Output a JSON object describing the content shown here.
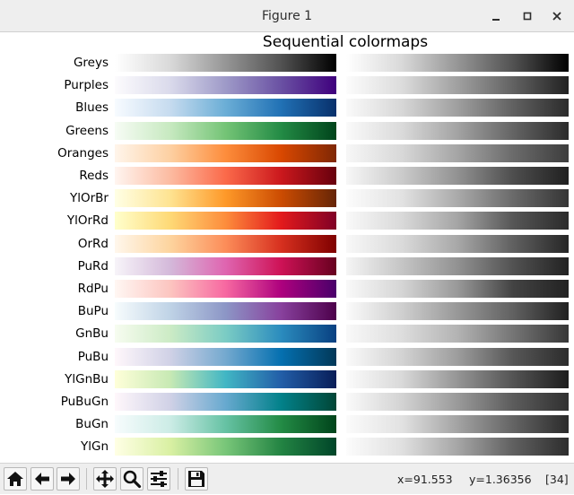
{
  "window": {
    "title": "Figure 1"
  },
  "figure": {
    "title": "Sequential colormaps"
  },
  "colormaps": [
    {
      "name": "Greys",
      "colors": [
        "#ffffff",
        "#d9d9d9",
        "#969696",
        "#525252",
        "#000000"
      ]
    },
    {
      "name": "Purples",
      "colors": [
        "#fcfbfd",
        "#dadaeb",
        "#9e9ac8",
        "#6a51a3",
        "#3f007d"
      ]
    },
    {
      "name": "Blues",
      "colors": [
        "#f7fbff",
        "#c6dbef",
        "#6baed6",
        "#2171b5",
        "#08306b"
      ]
    },
    {
      "name": "Greens",
      "colors": [
        "#f7fcf5",
        "#c7e9c0",
        "#74c476",
        "#238b45",
        "#00441b"
      ]
    },
    {
      "name": "Oranges",
      "colors": [
        "#fff5eb",
        "#fdd0a2",
        "#fd8d3c",
        "#d94801",
        "#7f2704"
      ]
    },
    {
      "name": "Reds",
      "colors": [
        "#fff5f0",
        "#fcbba1",
        "#fb6a4a",
        "#cb181d",
        "#67000d"
      ]
    },
    {
      "name": "YlOrBr",
      "colors": [
        "#ffffe5",
        "#fee391",
        "#fe9929",
        "#cc4c02",
        "#662506"
      ]
    },
    {
      "name": "YlOrRd",
      "colors": [
        "#ffffcc",
        "#fed976",
        "#fd8d3c",
        "#e31a1c",
        "#800026"
      ]
    },
    {
      "name": "OrRd",
      "colors": [
        "#fff7ec",
        "#fdd49e",
        "#fc8d59",
        "#d7301f",
        "#7f0000"
      ]
    },
    {
      "name": "PuRd",
      "colors": [
        "#f7f4f9",
        "#d4b9da",
        "#df65b0",
        "#ce1256",
        "#67001f"
      ]
    },
    {
      "name": "RdPu",
      "colors": [
        "#fff7f3",
        "#fcc5c0",
        "#f768a1",
        "#ae017e",
        "#49006a"
      ]
    },
    {
      "name": "BuPu",
      "colors": [
        "#f7fcfd",
        "#bfd3e6",
        "#8c96c6",
        "#88419d",
        "#4d004b"
      ]
    },
    {
      "name": "GnBu",
      "colors": [
        "#f7fcf0",
        "#ccebc5",
        "#7bccc4",
        "#2b8cbe",
        "#084081"
      ]
    },
    {
      "name": "PuBu",
      "colors": [
        "#fff7fb",
        "#d0d1e6",
        "#74a9cf",
        "#0570b0",
        "#023858"
      ]
    },
    {
      "name": "YlGnBu",
      "colors": [
        "#ffffd9",
        "#c7e9b4",
        "#41b6c4",
        "#225ea8",
        "#081d58"
      ]
    },
    {
      "name": "PuBuGn",
      "colors": [
        "#fff7fb",
        "#d0d1e6",
        "#67a9cf",
        "#02818a",
        "#014636"
      ]
    },
    {
      "name": "BuGn",
      "colors": [
        "#f7fcfd",
        "#ccece6",
        "#66c2a4",
        "#238b45",
        "#00441b"
      ]
    },
    {
      "name": "YlGn",
      "colors": [
        "#ffffe5",
        "#d9f0a3",
        "#78c679",
        "#238443",
        "#004529"
      ]
    }
  ],
  "toolbar": {
    "buttons": [
      {
        "name": "home-button",
        "icon": "home-icon"
      },
      {
        "name": "back-button",
        "icon": "arrow-left-icon"
      },
      {
        "name": "forward-button",
        "icon": "arrow-right-icon"
      },
      {
        "name": "pan-button",
        "icon": "move-icon"
      },
      {
        "name": "zoom-button",
        "icon": "magnifier-icon"
      },
      {
        "name": "configure-subplots-button",
        "icon": "sliders-icon"
      },
      {
        "name": "save-button",
        "icon": "floppy-disk-icon"
      }
    ],
    "coords": {
      "x": "x=91.553",
      "y": "y=1.36356",
      "value": "[34]"
    }
  }
}
